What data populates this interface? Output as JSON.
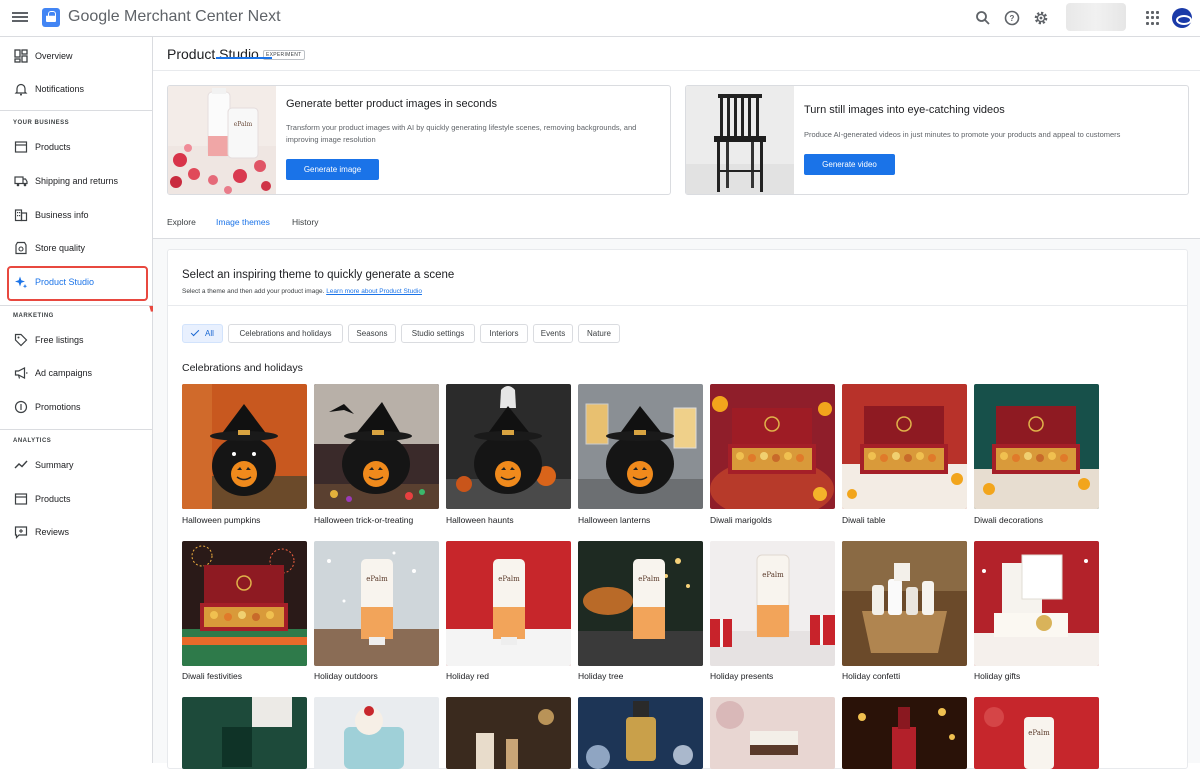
{
  "app": {
    "title": "Google Merchant Center Next"
  },
  "sidebar": {
    "items": [
      {
        "label": "Overview"
      },
      {
        "label": "Notifications"
      },
      {
        "label": "Products"
      },
      {
        "label": "Shipping and returns"
      },
      {
        "label": "Business info"
      },
      {
        "label": "Store quality"
      },
      {
        "label": "Product Studio"
      },
      {
        "label": "Free listings"
      },
      {
        "label": "Ad campaigns"
      },
      {
        "label": "Promotions"
      },
      {
        "label": "Summary"
      },
      {
        "label": "Products"
      },
      {
        "label": "Reviews"
      }
    ],
    "sections": {
      "business": "YOUR BUSINESS",
      "marketing": "MARKETING",
      "analytics": "ANALYTICS"
    }
  },
  "page": {
    "title": "Product Studio",
    "badge": "EXPERIMENT"
  },
  "promo_image": {
    "title": "Generate better product images in seconds",
    "desc": "Transform your product images with AI by quickly generating lifestyle scenes, removing backgrounds, and improving image resolution",
    "button": "Generate image"
  },
  "promo_video": {
    "title": "Turn still images into eye-catching videos",
    "desc": "Produce AI-generated videos in just minutes to promote your products and appeal to customers",
    "button": "Generate video"
  },
  "tabs": [
    {
      "label": "Explore"
    },
    {
      "label": "Image themes"
    },
    {
      "label": "History"
    }
  ],
  "active_tab": "Image themes",
  "themes_panel": {
    "title": "Select an inspiring theme to quickly generate a scene",
    "subtitle": "Select a theme and then add your product image.",
    "link": "Learn more about Product Studio",
    "chips": [
      {
        "label": "All"
      },
      {
        "label": "Celebrations and holidays"
      },
      {
        "label": "Seasons"
      },
      {
        "label": "Studio settings"
      },
      {
        "label": "Interiors"
      },
      {
        "label": "Events"
      },
      {
        "label": "Nature"
      }
    ],
    "group_title": "Celebrations and holidays",
    "themes": [
      {
        "label": "Halloween pumpkins"
      },
      {
        "label": "Halloween trick-or-treating"
      },
      {
        "label": "Halloween haunts"
      },
      {
        "label": "Halloween lanterns"
      },
      {
        "label": "Diwali marigolds"
      },
      {
        "label": "Diwali table"
      },
      {
        "label": "Diwali decorations"
      },
      {
        "label": "Diwali festivities"
      },
      {
        "label": "Holiday outdoors"
      },
      {
        "label": "Holiday red"
      },
      {
        "label": "Holiday tree"
      },
      {
        "label": "Holiday presents"
      },
      {
        "label": "Holiday confetti"
      },
      {
        "label": "Holiday gifts"
      }
    ]
  },
  "colors": {
    "accent": "#1a73e8",
    "highlight": "#e8483f"
  }
}
